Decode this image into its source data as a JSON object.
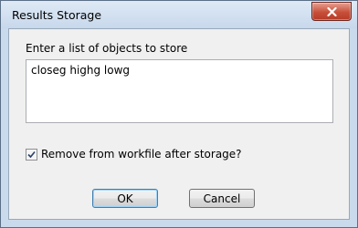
{
  "window": {
    "title": "Results Storage"
  },
  "dialog": {
    "prompt_label": "Enter a list of objects to store",
    "objects_value": "closeg highg lowg",
    "remove_checkbox": {
      "label": "Remove from workfile after storage?",
      "checked": true
    },
    "ok_label": "OK",
    "cancel_label": "Cancel"
  },
  "icons": {
    "close": "close-icon",
    "check": "checkmark-icon"
  },
  "colors": {
    "close_button": "#c7503b",
    "frame": "#c9daed",
    "client": "#f0f0f0"
  }
}
